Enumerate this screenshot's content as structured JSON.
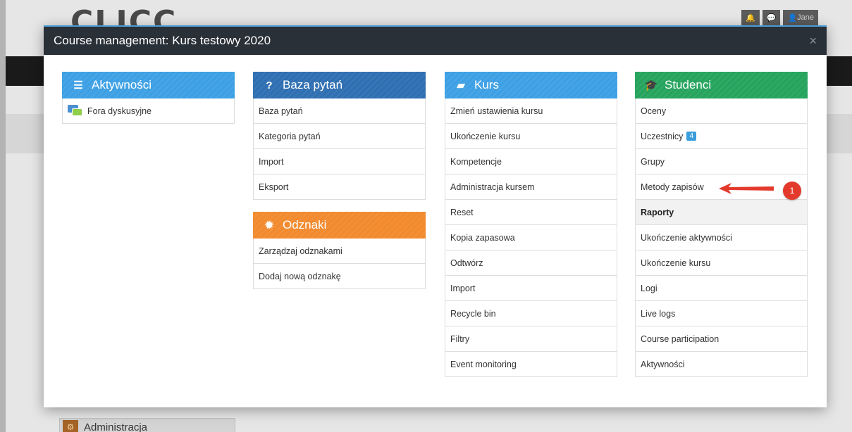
{
  "background": {
    "logo": "CLICC",
    "user_label": "Jane",
    "admin_label": "Administracja"
  },
  "modal": {
    "title": "Course management: Kurs testowy 2020",
    "close": "×"
  },
  "aktywnosci": {
    "title": "Aktywności",
    "items": [
      "Fora dyskusyjne"
    ]
  },
  "baza": {
    "title": "Baza pytań",
    "items": [
      "Baza pytań",
      "Kategoria pytań",
      "Import",
      "Eksport"
    ]
  },
  "odznaki": {
    "title": "Odznaki",
    "items": [
      "Zarządzaj odznakami",
      "Dodaj nową odznakę"
    ]
  },
  "kurs": {
    "title": "Kurs",
    "items": [
      "Zmień ustawienia kursu",
      "Ukończenie kursu",
      "Kompetencje",
      "Administracja kursem",
      "Reset",
      "Kopia zapasowa",
      "Odtwórz",
      "Import",
      "Recycle bin",
      "Filtry",
      "Event monitoring"
    ]
  },
  "studenci": {
    "title": "Studenci",
    "items": [
      "Oceny",
      "Uczestnicy",
      "Grupy",
      "Metody zapisów"
    ],
    "participants_count": "4",
    "raporty_heading": "Raporty",
    "raporty_items": [
      "Ukończenie aktywności",
      "Ukończenie kursu",
      "Logi",
      "Live logs",
      "Course participation",
      "Aktywności"
    ]
  },
  "annotation": {
    "number": "1",
    "color": "#e33a2c"
  },
  "colors": {
    "aktywnosci": "#3ea0e4",
    "baza": "#2f6fb2",
    "odznaki": "#f28a2e",
    "kurs": "#3ea0e4",
    "studenci": "#26a45e"
  }
}
